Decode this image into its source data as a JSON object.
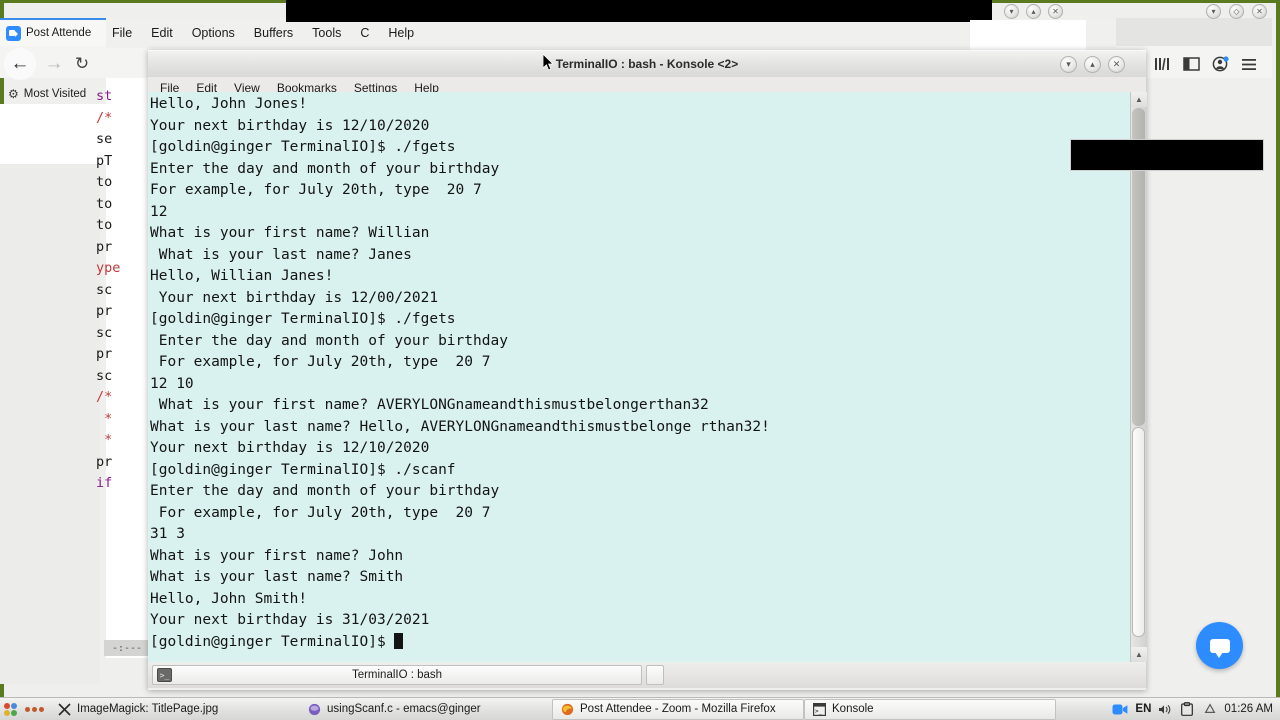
{
  "desktop": {
    "frame_color": "#5b7a1f"
  },
  "firefox": {
    "tab_title": "Post Attende",
    "tab_favicon": "zoom-icon",
    "back_icon": "back-arrow-icon",
    "forward_icon": "forward-arrow-icon",
    "reload_icon": "reload-icon",
    "page_icon": "page-icon",
    "bookmarks_label": "Most Visited",
    "bookmarks_icon": "gear-icon",
    "right_icons": [
      "library-icon",
      "sidebar-icon",
      "account-icon",
      "menu-icon"
    ]
  },
  "emacs": {
    "menus": [
      "File",
      "Edit",
      "Options",
      "Buffers",
      "Tools",
      "C",
      "Help"
    ],
    "modeline": "-:---",
    "code_fragments": [
      "st",
      "/*",
      "se",
      "pT",
      "to",
      "to",
      "to",
      "",
      "pr",
      "ype",
      "sc",
      "",
      "pr",
      "sc",
      "",
      "pr",
      "sc",
      "",
      "/*",
      " *",
      " *",
      "pr",
      "if"
    ]
  },
  "konsole": {
    "title": "TerminalIO : bash - Konsole <2>",
    "menus": [
      "File",
      "Edit",
      "View",
      "Bookmarks",
      "Settings",
      "Help"
    ],
    "window_buttons": [
      "minimize",
      "maximize",
      "close"
    ],
    "tab_label": "TerminalIO : bash",
    "tab_icon": "terminal-icon",
    "background_color": "#d9f2ef",
    "terminal_lines": [
      "Hello, John Jones!",
      "Your next birthday is 12/10/2020",
      "[goldin@ginger TerminalIO]$ ./fgets",
      "Enter the day and month of your birthday",
      "For example, for July 20th, type  20 7",
      "12",
      "What is your first name? Willian",
      " What is your last name? Janes",
      "Hello, Willian Janes!",
      " Your next birthday is 12/00/2021",
      "[goldin@ginger TerminalIO]$ ./fgets",
      " Enter the day and month of your birthday",
      " For example, for July 20th, type  20 7",
      "12 10",
      " What is your first name? AVERYLONGnameandthismustbelongerthan32",
      "What is your last name? Hello, AVERYLONGnameandthismustbelonge rthan32!",
      "Your next birthday is 12/10/2020",
      "[goldin@ginger TerminalIO]$ ./scanf",
      "Enter the day and month of your birthday",
      " For example, for July 20th, type  20 7",
      "31 3",
      "What is your first name? John",
      "What is your last name? Smith",
      "Hello, John Smith!",
      "Your next birthday is 31/03/2021",
      "[goldin@ginger TerminalIO]$ "
    ]
  },
  "taskbar": {
    "items": [
      {
        "label": "ImageMagick: TitlePage.jpg",
        "icon": "imagemagick-icon"
      },
      {
        "label": "usingScanf.c - emacs@ginger",
        "icon": "emacs-icon"
      },
      {
        "label": "Post Attendee - Zoom - Mozilla Firefox",
        "icon": "firefox-icon"
      },
      {
        "label": "Konsole",
        "icon": "konsole-icon"
      }
    ],
    "systray": [
      "zoom-icon",
      "volume-icon",
      "clipboard-icon",
      "updates-icon"
    ],
    "keyboard_layout": "EN",
    "clock": "01:26 AM"
  },
  "chat": {
    "icon": "chat-bubble-icon",
    "color": "#2d8cff"
  }
}
